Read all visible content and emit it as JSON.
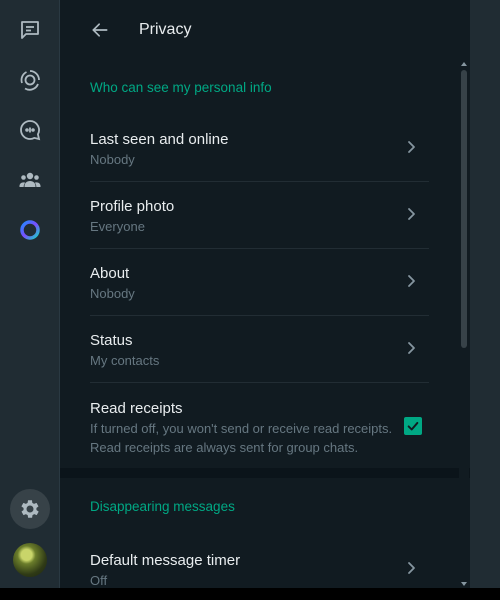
{
  "rail": {
    "items": [
      {
        "name": "chats-icon"
      },
      {
        "name": "status-icon"
      },
      {
        "name": "channels-icon"
      },
      {
        "name": "communities-icon"
      },
      {
        "name": "meta-ai-icon"
      }
    ],
    "settings_icon": "gear-icon",
    "profile_icon": "avatar"
  },
  "header": {
    "title": "Privacy",
    "back_icon": "arrow-left-icon"
  },
  "personal_info": {
    "title": "Who can see my personal info",
    "items": [
      {
        "label": "Last seen and online",
        "value": "Nobody"
      },
      {
        "label": "Profile photo",
        "value": "Everyone"
      },
      {
        "label": "About",
        "value": "Nobody"
      },
      {
        "label": "Status",
        "value": "My contacts"
      }
    ],
    "read_receipts": {
      "label": "Read receipts",
      "description_line1": "If turned off, you won't send or receive read receipts.",
      "description_line2": "Read receipts are always sent for group chats.",
      "checked": true
    }
  },
  "disappearing": {
    "title": "Disappearing messages",
    "items": [
      {
        "label": "Default message timer",
        "value": "Off"
      }
    ]
  },
  "colors": {
    "accent": "#00a884",
    "background": "#111b21",
    "rail": "#202c33",
    "secondary_text": "#667781",
    "primary_text": "#e9edef"
  }
}
